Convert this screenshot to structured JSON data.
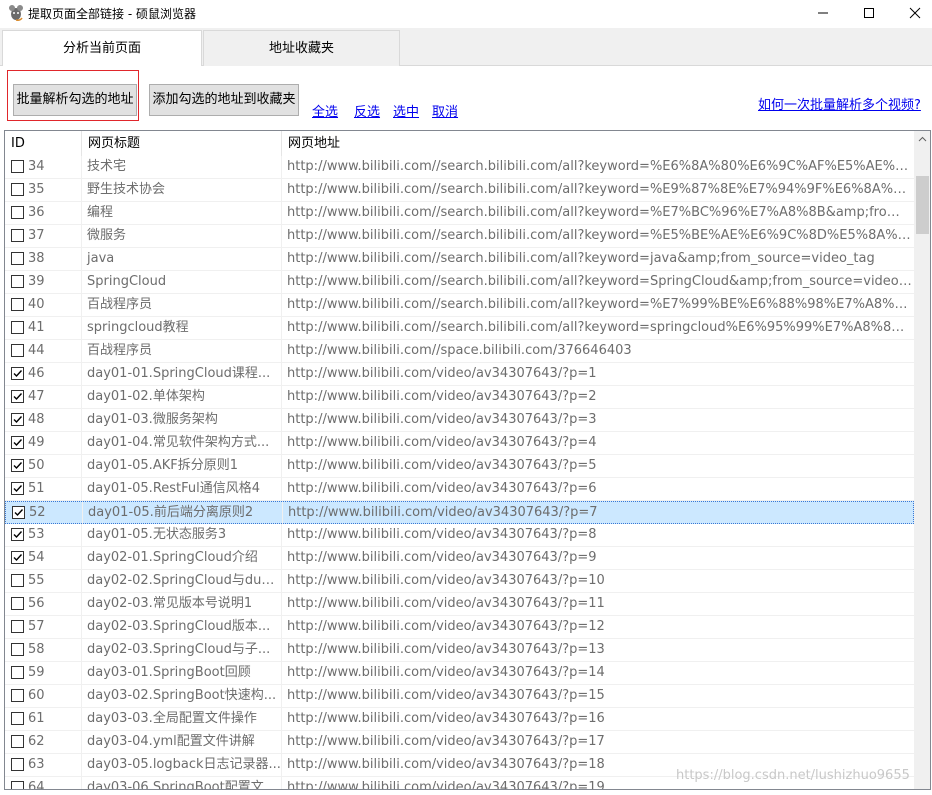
{
  "window": {
    "title": "提取页面全部链接 - 硕鼠浏览器"
  },
  "tabs": [
    {
      "label": "分析当前页面"
    },
    {
      "label": "地址收藏夹"
    }
  ],
  "toolbar": {
    "parse_label": "批量解析勾选的地址",
    "fav_label": "添加勾选的地址到收藏夹",
    "select_all": "全选",
    "invert": "反选",
    "select": "选中",
    "cancel": "取消",
    "help_link": "如何一次批量解析多个视频?"
  },
  "table": {
    "columns": [
      "ID",
      "网页标题",
      "网页地址"
    ],
    "rows": [
      {
        "id": "34",
        "title": "技术宅",
        "url": "http://www.bilibili.com//search.bilibili.com/all?keyword=%E6%8A%80%E6%9C%AF%E5%AE%85&...",
        "checked": false
      },
      {
        "id": "35",
        "title": "野生技术协会",
        "url": "http://www.bilibili.com//search.bilibili.com/all?keyword=%E9%87%8E%E7%94%9F%E6%8A%80%...",
        "checked": false
      },
      {
        "id": "36",
        "title": "编程",
        "url": "http://www.bilibili.com//search.bilibili.com/all?keyword=%E7%BC%96%E7%A8%8B&amp;from_so...",
        "checked": false
      },
      {
        "id": "37",
        "title": "微服务",
        "url": "http://www.bilibili.com//search.bilibili.com/all?keyword=%E5%BE%AE%E6%9C%8D%E5%8A%A1&...",
        "checked": false
      },
      {
        "id": "38",
        "title": "java",
        "url": "http://www.bilibili.com//search.bilibili.com/all?keyword=java&amp;from_source=video_tag",
        "checked": false
      },
      {
        "id": "39",
        "title": "SpringCloud",
        "url": "http://www.bilibili.com//search.bilibili.com/all?keyword=SpringCloud&amp;from_source=video_tag",
        "checked": false
      },
      {
        "id": "40",
        "title": "百战程序员",
        "url": "http://www.bilibili.com//search.bilibili.com/all?keyword=%E7%99%BE%E6%88%98%E7%A8%8B%...",
        "checked": false
      },
      {
        "id": "41",
        "title": "springcloud教程",
        "url": "http://www.bilibili.com//search.bilibili.com/all?keyword=springcloud%E6%95%99%E7%A8%8B&a...",
        "checked": false
      },
      {
        "id": "44",
        "title": "百战程序员",
        "url": "http://www.bilibili.com//space.bilibili.com/376646403",
        "checked": false
      },
      {
        "id": "46",
        "title": "day01-01.SpringCloud课程...",
        "url": "http://www.bilibili.com/video/av34307643/?p=1",
        "checked": true
      },
      {
        "id": "47",
        "title": "day01-02.单体架构",
        "url": "http://www.bilibili.com/video/av34307643/?p=2",
        "checked": true
      },
      {
        "id": "48",
        "title": "day01-03.微服务架构",
        "url": "http://www.bilibili.com/video/av34307643/?p=3",
        "checked": true
      },
      {
        "id": "49",
        "title": "day01-04.常见软件架构方式...",
        "url": "http://www.bilibili.com/video/av34307643/?p=4",
        "checked": true
      },
      {
        "id": "50",
        "title": "day01-05.AKF拆分原则1",
        "url": "http://www.bilibili.com/video/av34307643/?p=5",
        "checked": true
      },
      {
        "id": "51",
        "title": "day01-05.RestFul通信风格4",
        "url": "http://www.bilibili.com/video/av34307643/?p=6",
        "checked": true
      },
      {
        "id": "52",
        "title": "day01-05.前后端分离原则2",
        "url": "http://www.bilibili.com/video/av34307643/?p=7",
        "checked": true,
        "selected": true
      },
      {
        "id": "53",
        "title": "day01-05.无状态服务3",
        "url": "http://www.bilibili.com/video/av34307643/?p=8",
        "checked": true
      },
      {
        "id": "54",
        "title": "day02-01.SpringCloud介绍",
        "url": "http://www.bilibili.com/video/av34307643/?p=9",
        "checked": true
      },
      {
        "id": "55",
        "title": "day02-02.SpringCloud与dub...",
        "url": "http://www.bilibili.com/video/av34307643/?p=10",
        "checked": false
      },
      {
        "id": "56",
        "title": "day02-03.常见版本号说明1",
        "url": "http://www.bilibili.com/video/av34307643/?p=11",
        "checked": false
      },
      {
        "id": "57",
        "title": "day02-03.SpringCloud版本...",
        "url": "http://www.bilibili.com/video/av34307643/?p=12",
        "checked": false
      },
      {
        "id": "58",
        "title": "day02-03.SpringCloud与子...",
        "url": "http://www.bilibili.com/video/av34307643/?p=13",
        "checked": false
      },
      {
        "id": "59",
        "title": "day03-01.SpringBoot回顾",
        "url": "http://www.bilibili.com/video/av34307643/?p=14",
        "checked": false
      },
      {
        "id": "60",
        "title": "day03-02.SpringBoot快速构...",
        "url": "http://www.bilibili.com/video/av34307643/?p=15",
        "checked": false
      },
      {
        "id": "61",
        "title": "day03-03.全局配置文件操作",
        "url": "http://www.bilibili.com/video/av34307643/?p=16",
        "checked": false
      },
      {
        "id": "62",
        "title": "day03-04.yml配置文件讲解",
        "url": "http://www.bilibili.com/video/av34307643/?p=17",
        "checked": false
      },
      {
        "id": "63",
        "title": "day03-05.logback日志记录器...",
        "url": "http://www.bilibili.com/video/av34307643/?p=18",
        "checked": false
      },
      {
        "id": "64",
        "title": "day03-06.SpringBoot配置文...",
        "url": "http://www.bilibili.com/video/av34307643/?p=19",
        "checked": false
      }
    ]
  },
  "watermark": "https://blog.csdn.net/lushizhuo9655",
  "colors": {
    "selected_row": "#cce8ff",
    "link": "#0000ee",
    "focus_border": "#e0262b"
  }
}
